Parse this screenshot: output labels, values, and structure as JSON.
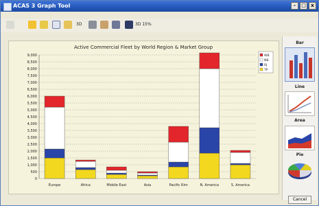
{
  "window": {
    "title": "ACAS 3 Graph Tool",
    "min_label": "-",
    "max_label": "□",
    "close_label": "x"
  },
  "toolbar": {
    "view_3d_label": "3D",
    "zoom_label": "3D 15%"
  },
  "right_panel": {
    "bar_label": "Bar",
    "line_label": "Line",
    "area_label": "Area",
    "pie_label": "Pie"
  },
  "footer": {
    "cancel_label": "Cancel"
  },
  "colors": {
    "red": "#e3262b",
    "white": "#ffffff",
    "blue": "#2a45a8",
    "yellow": "#f2d81f"
  },
  "chart_data": {
    "type": "bar",
    "title": "Active Commercial Fleet by World Region & Market Group",
    "categories": [
      "Europe",
      "Africa",
      "Middle East",
      "Asia",
      "Pacific Rim",
      "N. America",
      "S. America"
    ],
    "series": [
      {
        "name": "TP",
        "values": [
          1500,
          650,
          300,
          200,
          850,
          1850,
          1000
        ]
      },
      {
        "name": "RJ",
        "values": [
          650,
          150,
          100,
          50,
          350,
          1850,
          100
        ]
      },
      {
        "name": "NB",
        "values": [
          3050,
          450,
          200,
          150,
          1450,
          4300,
          800
        ]
      },
      {
        "name": "WB",
        "values": [
          800,
          100,
          250,
          100,
          1150,
          1150,
          150
        ]
      }
    ],
    "ylim": [
      0,
      9000
    ],
    "yticks": [
      "0",
      "500",
      "1,000",
      "1,500",
      "2,000",
      "2,500",
      "3,000",
      "3,500",
      "4,000",
      "4,500",
      "5,000",
      "5,500",
      "6,000",
      "6,500",
      "7,000",
      "7,500",
      "8,000",
      "8,500",
      "9,000"
    ],
    "legend": [
      "WB",
      "NB",
      "RJ",
      "TP"
    ],
    "legend_position": "top-right",
    "grid": true
  }
}
